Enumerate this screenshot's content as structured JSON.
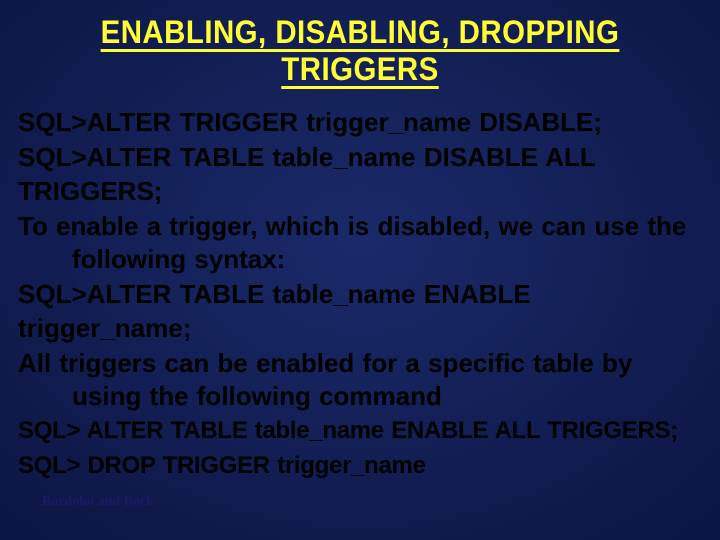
{
  "title": "ENABLING, DISABLING, DROPPING TRIGGERS",
  "lines": {
    "l1": "SQL>ALTER TRIGGER trigger_name DISABLE;",
    "l2": "SQL>ALTER TABLE table_name DISABLE ALL TRIGGERS;",
    "l3": "To enable a trigger, which is disabled, we can use the following syntax:",
    "l4": "SQL>ALTER TABLE table_name ENABLE trigger_name;",
    "l5": "All triggers can be enabled for a specific table by using the following command",
    "l6": "SQL> ALTER TABLE table_name ENABLE ALL TRIGGERS;",
    "l7": "SQL> DROP TRIGGER trigger_name"
  },
  "footer": "Bordoloi and Bock"
}
